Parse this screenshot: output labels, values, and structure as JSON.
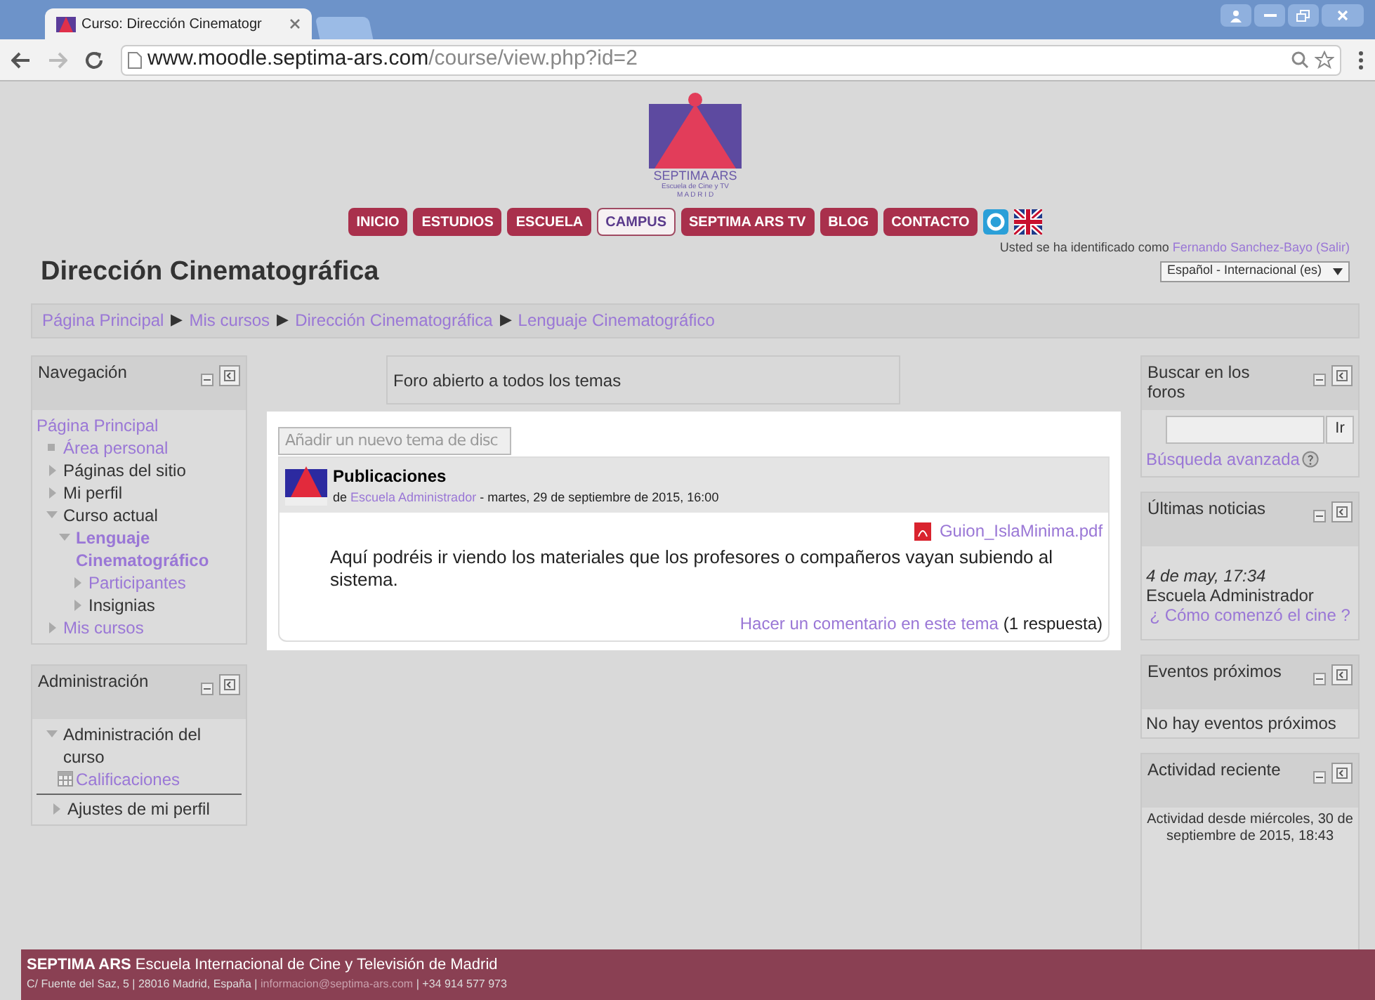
{
  "browser": {
    "tab_title": "Curso: Dirección Cinematogr",
    "url_host": "www.moodle.septima-ars.com",
    "url_path": "/course/view.php?id=2"
  },
  "logo": {
    "name": "SEPTIMA ARS",
    "subtitle": "Escuela de Cine y TV",
    "city": "M A D R I D"
  },
  "nav_buttons": [
    {
      "label": "INICIO",
      "selected": false
    },
    {
      "label": "ESTUDIOS",
      "selected": false
    },
    {
      "label": "ESCUELA",
      "selected": false
    },
    {
      "label": "CAMPUS",
      "selected": true
    },
    {
      "label": "SEPTIMA ARS TV",
      "selected": false
    },
    {
      "label": "BLOG",
      "selected": false
    },
    {
      "label": "CONTACTO",
      "selected": false
    }
  ],
  "page_title": "Dirección Cinematográfica",
  "user_info": {
    "prefix": "Usted se ha identificado como",
    "user": "Fernando Sanchez-Bayo",
    "logout": "(Salir)",
    "language": "Español - Internacional (es)"
  },
  "breadcrumb": {
    "separator": "▶",
    "items": [
      "Página Principal",
      "Mis cursos",
      "Dirección Cinematográfica",
      "Lenguaje Cinematográfico"
    ]
  },
  "navigation": {
    "title": "Navegación",
    "items": [
      {
        "label": "Página Principal",
        "kind": "root",
        "link": true,
        "current": false,
        "children": [
          {
            "label": "Área personal",
            "kind": "leaf",
            "link": true,
            "current": false
          },
          {
            "label": "Páginas del sitio",
            "kind": "branch",
            "expanded": false,
            "link": false,
            "current": false
          },
          {
            "label": "Mi perfil",
            "kind": "branch",
            "expanded": false,
            "link": false,
            "current": false
          },
          {
            "label": "Curso actual",
            "kind": "branch",
            "expanded": true,
            "link": false,
            "current": false,
            "children": [
              {
                "label": "Lenguaje Cinematográfico",
                "kind": "branch",
                "expanded": true,
                "link": true,
                "current": true,
                "children": [
                  {
                    "label": "Participantes",
                    "kind": "branch",
                    "expanded": false,
                    "link": true,
                    "current": false
                  },
                  {
                    "label": "Insignias",
                    "kind": "branch",
                    "expanded": false,
                    "link": false,
                    "current": false
                  }
                ]
              }
            ]
          },
          {
            "label": "Mis cursos",
            "kind": "branch",
            "expanded": false,
            "link": true,
            "current": false
          }
        ]
      }
    ]
  },
  "administration": {
    "title": "Administración",
    "items": [
      {
        "label": "Administración del curso",
        "kind": "branch",
        "expanded": true,
        "link": false,
        "current": false,
        "children": [
          {
            "label": "Calificaciones",
            "kind": "grades",
            "link": true,
            "current": false
          }
        ]
      },
      {
        "label": "Ajustes de mi perfil",
        "kind": "branch",
        "expanded": false,
        "link": false,
        "current": false
      }
    ]
  },
  "forum": {
    "intro": "Foro abierto a todos los temas",
    "add_button": "Añadir un nuevo tema de disc",
    "post": {
      "subject": "Publicaciones",
      "by": "de",
      "author": "Escuela Administrador",
      "date": "- martes, 29 de septiembre de 2015, 16:00",
      "attachment": "Guion_IslaMinima.pdf",
      "body": "Aquí podréis ir viendo los materiales que los profesores o compañeros vayan subiendo al sistema.",
      "reply_link": "Hacer un comentario en este tema",
      "reply_count": "(1 respuesta)"
    }
  },
  "search_block": {
    "title": "Buscar en los foros",
    "button": "Ir",
    "advanced": "Búsqueda avanzada"
  },
  "news_block": {
    "title": "Últimas noticias",
    "date": "4 de may, 17:34",
    "author": "Escuela Administrador",
    "link": "¿ Cómo comenzó el cine ?"
  },
  "events_block": {
    "title": "Eventos próximos",
    "text": "No hay eventos próximos"
  },
  "activity_block": {
    "title": "Actividad reciente",
    "text": "Actividad desde miércoles, 30 de septiembre de 2015, 18:43"
  },
  "footer": {
    "brand": "SEPTIMA ARS",
    "tagline": "Escuela Internacional de Cine y Televisión de Madrid",
    "address": "C/ Fuente del Saz, 5 | 28016 Madrid, España |",
    "email": "informacion@septima-ars.com",
    "phone": "| +34 914 577 973"
  }
}
